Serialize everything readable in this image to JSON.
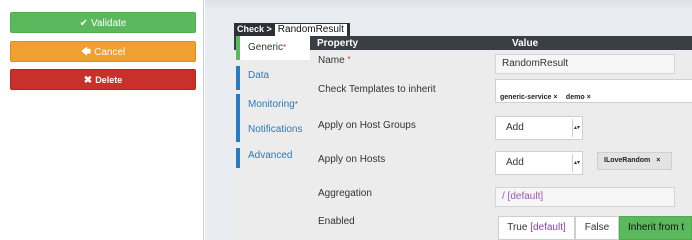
{
  "actions": {
    "validate": {
      "icon": "✔",
      "label": "Validate"
    },
    "cancel": {
      "icon": "🡄",
      "label": "Cancel"
    },
    "delete": {
      "icon": "✖",
      "label": "Delete"
    }
  },
  "breadcrumb": {
    "root": "Check >",
    "current": "RandomResult"
  },
  "tabs": [
    {
      "label": "Generic",
      "required": "*"
    },
    {
      "label": "Data"
    },
    {
      "label": "Monitoring",
      "required": "*"
    },
    {
      "label": "Notifications"
    },
    {
      "label": "Advanced"
    }
  ],
  "table": {
    "property_header": "Property",
    "value_header": "Value"
  },
  "properties": {
    "name": {
      "label": "Name",
      "required": "*",
      "value": "RandomResult"
    },
    "templates": {
      "label": "Check Templates to inherit",
      "tags": [
        "generic-service",
        "demo"
      ],
      "remove": "×"
    },
    "host_groups": {
      "label": "Apply on Host Groups",
      "select": "Add",
      "caret": "▲\n▼"
    },
    "hosts": {
      "label": "Apply on Hosts",
      "select": "Add",
      "tag": "ILoveRandom",
      "remove": "×"
    },
    "aggregation": {
      "label": "Aggregation",
      "value": "/ [default]"
    },
    "enabled": {
      "label": "Enabled",
      "option_true": "True",
      "option_true_default": "[default]",
      "option_false": "False",
      "option_inherit": "Inherit from t"
    }
  },
  "colors": {
    "validate": "#5cb85c",
    "cancel": "#f0a030",
    "delete": "#c9302c",
    "tab_accent": "#2a7bbf",
    "header": "#3a3f46"
  }
}
